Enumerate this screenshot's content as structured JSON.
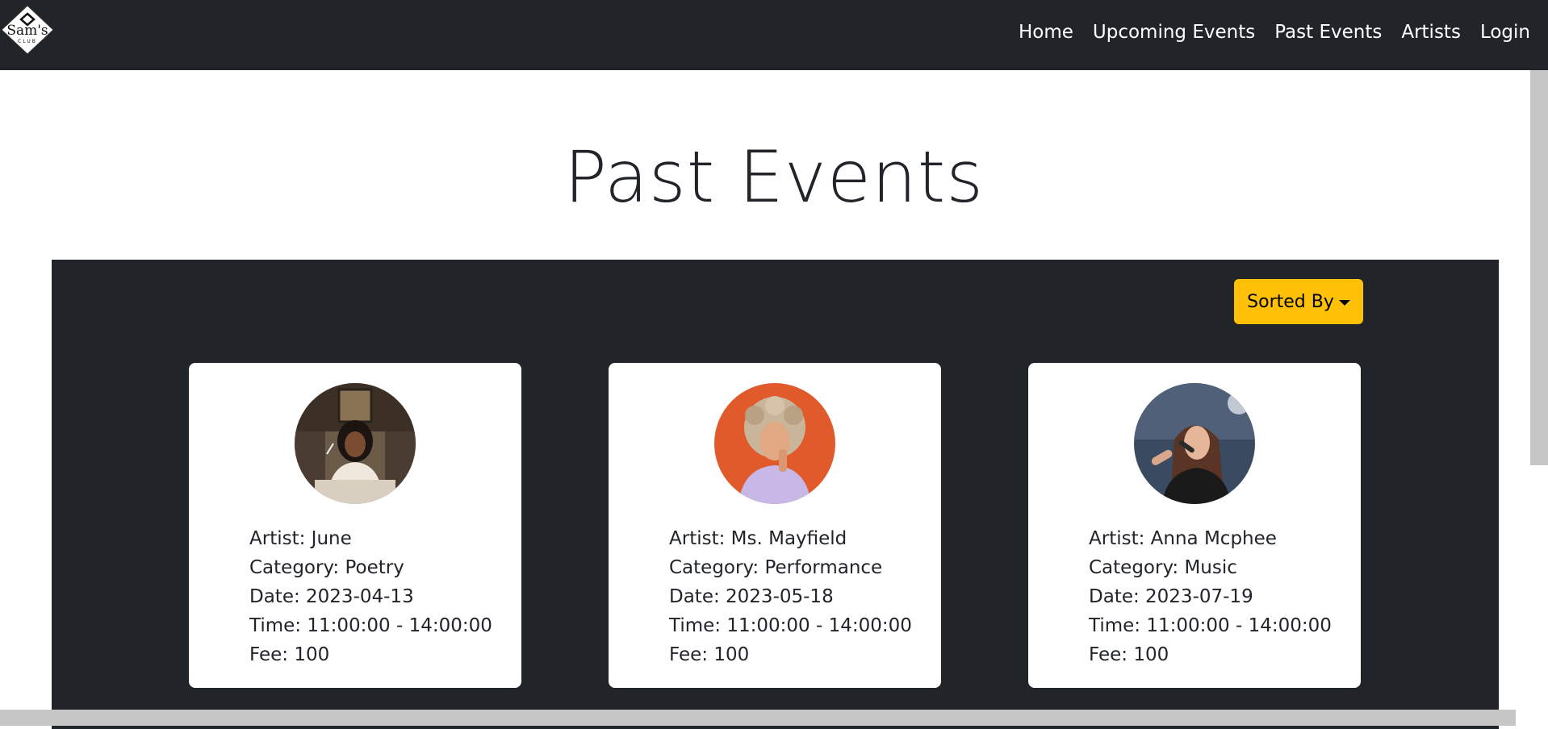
{
  "app": {
    "logo_text": "Sam's",
    "logo_sub": "CLUB"
  },
  "nav": {
    "links": [
      "Home",
      "Upcoming Events",
      "Past Events",
      "Artists",
      "Login"
    ]
  },
  "page": {
    "title": "Past Events"
  },
  "sort": {
    "label": "Sorted By"
  },
  "events": [
    {
      "artist": "Artist: June",
      "category": "Category: Poetry",
      "date": "Date: 2023-04-13",
      "time": "Time: 11:00:00 - 14:00:00",
      "fee": "Fee: 100",
      "avatar_colors": {
        "bg": "#6b5a48",
        "accent": "#efe7dc",
        "hair": "#1b1410"
      }
    },
    {
      "artist": "Artist: Ms. Mayfield",
      "category": "Category: Performance",
      "date": "Date: 2023-05-18",
      "time": "Time: 11:00:00 - 14:00:00",
      "fee": "Fee: 100",
      "avatar_colors": {
        "bg": "#e05a2c",
        "accent": "#c8b8e8",
        "hair": "#c9b59a"
      }
    },
    {
      "artist": "Artist: Anna Mcphee",
      "category": "Category: Music",
      "date": "Date: 2023-07-19",
      "time": "Time: 11:00:00 - 14:00:00",
      "fee": "Fee: 100",
      "avatar_colors": {
        "bg": "#3a4a60",
        "accent": "#1a1a1a",
        "hair": "#5a3424"
      }
    }
  ],
  "colors": {
    "navbar": "#212529",
    "panel": "#212529",
    "sort_button": "#ffc107",
    "card": "#ffffff"
  }
}
